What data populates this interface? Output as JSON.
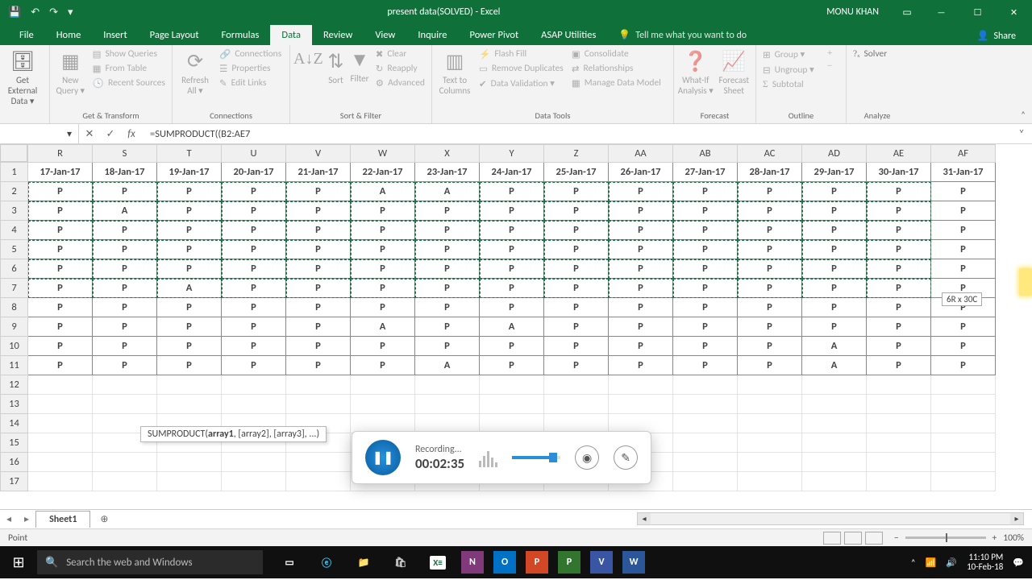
{
  "title": "present data(SOLVED) - Excel",
  "user": "MONU KHAN",
  "qat": {
    "save": "💾",
    "undo": "↶",
    "redo": "↷"
  },
  "tabs": [
    "File",
    "Home",
    "Insert",
    "Page Layout",
    "Formulas",
    "Data",
    "Review",
    "View",
    "Inquire",
    "Power Pivot",
    "ASAP Utilities"
  ],
  "active_tab": "Data",
  "tell_me": "Tell me what you want to do",
  "share": "Share",
  "ribbon": {
    "g1": {
      "label": "",
      "btn": "Get External\nData ▾"
    },
    "g2": {
      "label": "Get & Transform",
      "new": "New\nQuery ▾",
      "a": "Show Queries",
      "b": "From Table",
      "c": "Recent Sources"
    },
    "g3": {
      "label": "Connections",
      "ref": "Refresh\nAll ▾",
      "a": "Connections",
      "b": "Properties",
      "c": "Edit Links"
    },
    "g4": {
      "label": "Sort & Filter",
      "sort": "Sort",
      "filter": "Filter",
      "a": "Clear",
      "b": "Reapply",
      "c": "Advanced"
    },
    "g5": {
      "label": "Data Tools",
      "txt": "Text to\nColumns",
      "a": "Flash Fill",
      "b": "Remove Duplicates",
      "c": "Data Validation ▾",
      "d": "Consolidate",
      "e": "Relationships",
      "f": "Manage Data Model"
    },
    "g6": {
      "label": "Forecast",
      "a": "What-If\nAnalysis ▾",
      "b": "Forecast\nSheet"
    },
    "g7": {
      "label": "Outline",
      "a": "Group ▾",
      "b": "Ungroup ▾",
      "c": "Subtotal"
    },
    "g8": {
      "label": "Analyze",
      "a": "Solver"
    }
  },
  "namebox": "",
  "formula": "=SUMPRODUCT((B2:AE7",
  "columns": [
    "R",
    "S",
    "T",
    "U",
    "V",
    "W",
    "X",
    "Y",
    "Z",
    "AA",
    "AB",
    "AC",
    "AD",
    "AE",
    "AF"
  ],
  "rows": [
    1,
    2,
    3,
    4,
    5,
    6,
    7,
    8,
    9,
    10,
    11,
    12,
    13,
    14,
    15,
    16,
    17
  ],
  "headers": [
    "17-Jan-17",
    "18-Jan-17",
    "19-Jan-17",
    "20-Jan-17",
    "21-Jan-17",
    "22-Jan-17",
    "23-Jan-17",
    "24-Jan-17",
    "25-Jan-17",
    "26-Jan-17",
    "27-Jan-17",
    "28-Jan-17",
    "29-Jan-17",
    "30-Jan-17",
    "31-Jan-17"
  ],
  "data": [
    [
      "P",
      "P",
      "P",
      "P",
      "P",
      "A",
      "A",
      "P",
      "P",
      "P",
      "P",
      "P",
      "P",
      "P",
      "P"
    ],
    [
      "P",
      "A",
      "P",
      "P",
      "P",
      "P",
      "P",
      "P",
      "P",
      "P",
      "P",
      "P",
      "P",
      "P",
      "P"
    ],
    [
      "P",
      "P",
      "P",
      "P",
      "P",
      "P",
      "P",
      "P",
      "P",
      "P",
      "P",
      "P",
      "P",
      "P",
      "P"
    ],
    [
      "P",
      "P",
      "P",
      "P",
      "P",
      "P",
      "P",
      "P",
      "P",
      "P",
      "P",
      "P",
      "P",
      "P",
      "P"
    ],
    [
      "P",
      "P",
      "P",
      "P",
      "P",
      "P",
      "P",
      "P",
      "P",
      "P",
      "P",
      "P",
      "P",
      "P",
      "P"
    ],
    [
      "P",
      "P",
      "A",
      "P",
      "P",
      "P",
      "P",
      "P",
      "P",
      "P",
      "P",
      "P",
      "P",
      "P",
      "P"
    ],
    [
      "P",
      "P",
      "P",
      "P",
      "P",
      "P",
      "P",
      "P",
      "P",
      "P",
      "P",
      "P",
      "P",
      "P",
      "P"
    ],
    [
      "P",
      "P",
      "P",
      "P",
      "P",
      "A",
      "P",
      "A",
      "P",
      "P",
      "P",
      "P",
      "P",
      "P",
      "P"
    ],
    [
      "P",
      "P",
      "P",
      "P",
      "P",
      "P",
      "P",
      "P",
      "P",
      "P",
      "P",
      "P",
      "A",
      "P",
      "P"
    ],
    [
      "P",
      "P",
      "P",
      "P",
      "P",
      "P",
      "A",
      "P",
      "P",
      "P",
      "P",
      "P",
      "A",
      "P",
      "P"
    ]
  ],
  "sel_hint": "6R x 30C",
  "fn_tip_name": "SUMPRODUCT(",
  "fn_tip_bold": "array1",
  "fn_tip_rest": ", [array2], [array3], ...)",
  "recorder": {
    "label": "Recording...",
    "time": "00:02:35"
  },
  "sheet": "Sheet1",
  "status_mode": "Point",
  "zoom": "100%",
  "taskbar": {
    "search": "Search the web and Windows",
    "time": "11:10 PM",
    "date": "10-Feb-18"
  },
  "chart_data": {
    "type": "table",
    "title": "Attendance table (P=Present, A=Absent) for dates 17-Jan-17 through 31-Jan-17 across 10 rows; user is entering SUMPRODUCT formula over range B2:AE7",
    "columns": [
      "17-Jan-17",
      "18-Jan-17",
      "19-Jan-17",
      "20-Jan-17",
      "21-Jan-17",
      "22-Jan-17",
      "23-Jan-17",
      "24-Jan-17",
      "25-Jan-17",
      "26-Jan-17",
      "27-Jan-17",
      "28-Jan-17",
      "29-Jan-17",
      "30-Jan-17",
      "31-Jan-17"
    ],
    "rows": [
      [
        "P",
        "P",
        "P",
        "P",
        "P",
        "A",
        "A",
        "P",
        "P",
        "P",
        "P",
        "P",
        "P",
        "P",
        "P"
      ],
      [
        "P",
        "A",
        "P",
        "P",
        "P",
        "P",
        "P",
        "P",
        "P",
        "P",
        "P",
        "P",
        "P",
        "P",
        "P"
      ],
      [
        "P",
        "P",
        "P",
        "P",
        "P",
        "P",
        "P",
        "P",
        "P",
        "P",
        "P",
        "P",
        "P",
        "P",
        "P"
      ],
      [
        "P",
        "P",
        "P",
        "P",
        "P",
        "P",
        "P",
        "P",
        "P",
        "P",
        "P",
        "P",
        "P",
        "P",
        "P"
      ],
      [
        "P",
        "P",
        "P",
        "P",
        "P",
        "P",
        "P",
        "P",
        "P",
        "P",
        "P",
        "P",
        "P",
        "P",
        "P"
      ],
      [
        "P",
        "P",
        "A",
        "P",
        "P",
        "P",
        "P",
        "P",
        "P",
        "P",
        "P",
        "P",
        "P",
        "P",
        "P"
      ],
      [
        "P",
        "P",
        "P",
        "P",
        "P",
        "P",
        "P",
        "P",
        "P",
        "P",
        "P",
        "P",
        "P",
        "P",
        "P"
      ],
      [
        "P",
        "P",
        "P",
        "P",
        "P",
        "A",
        "P",
        "A",
        "P",
        "P",
        "P",
        "P",
        "P",
        "P",
        "P"
      ],
      [
        "P",
        "P",
        "P",
        "P",
        "P",
        "P",
        "P",
        "P",
        "P",
        "P",
        "P",
        "P",
        "A",
        "P",
        "P"
      ],
      [
        "P",
        "P",
        "P",
        "P",
        "P",
        "P",
        "A",
        "P",
        "P",
        "P",
        "P",
        "P",
        "A",
        "P",
        "P"
      ]
    ]
  }
}
